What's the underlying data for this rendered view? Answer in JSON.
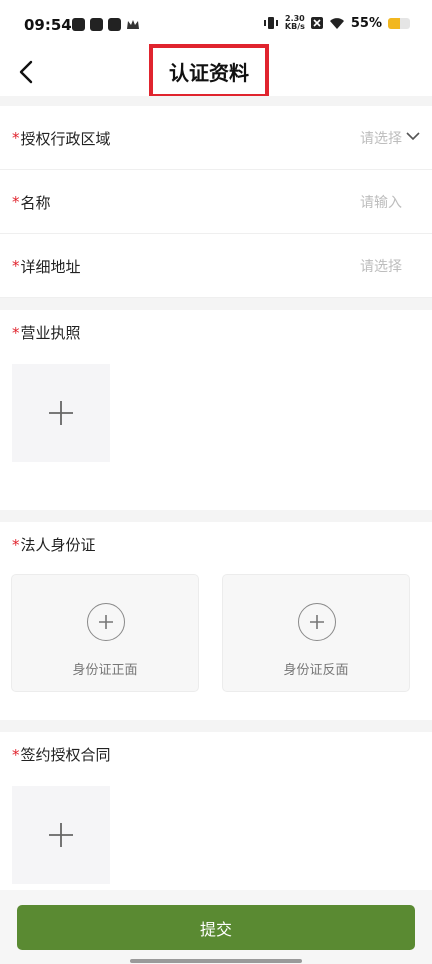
{
  "status_bar": {
    "time": "09:54",
    "net_speed_value": "2.30",
    "net_speed_unit": "KB/s",
    "battery_percent": "55%",
    "battery_level": 0.55,
    "battery_color": "#f2b71f"
  },
  "header": {
    "title": "认证资料",
    "back_icon": "chevron-left-icon"
  },
  "form": {
    "required_mark": "*",
    "region": {
      "label": "授权行政区域",
      "placeholder": "请选择"
    },
    "name": {
      "label": "名称",
      "placeholder": "请输入"
    },
    "address": {
      "label": "详细地址",
      "placeholder": "请选择"
    },
    "business_license": {
      "label": "营业执照"
    },
    "legal_id": {
      "label": "法人身份证",
      "front_label": "身份证正面",
      "back_label": "身份证反面"
    },
    "contract": {
      "label": "签约授权合同"
    }
  },
  "footer": {
    "submit_label": "提交",
    "submit_color": "#5a8a32"
  },
  "colors": {
    "required": "#e0242e",
    "title_highlight": "#e0242e"
  }
}
